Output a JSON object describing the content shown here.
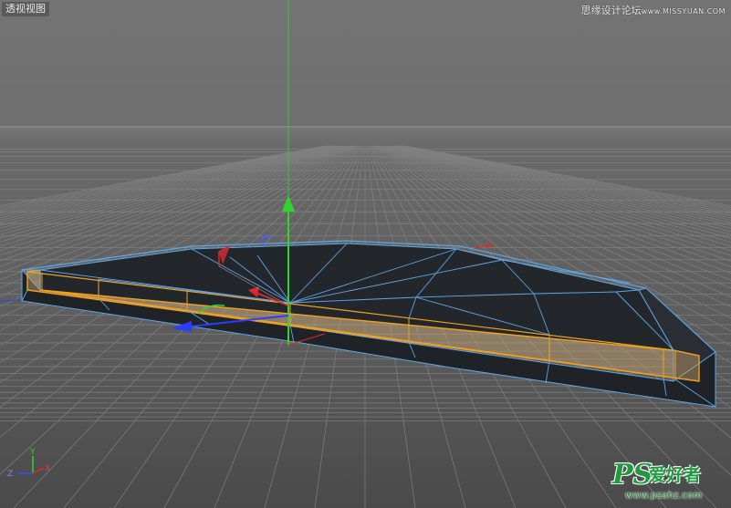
{
  "viewport": {
    "view_label": "透视视图"
  },
  "watermark_top": {
    "text": "思缘设计论坛",
    "url": "www.MISSYUAN.COM"
  },
  "watermark_bottom": {
    "brand": "PS",
    "chinese": "爱好者",
    "url": "www.psahz.com"
  },
  "axis_indicator": {
    "y_label": "Y",
    "z_label": "Z",
    "x_label": "X",
    "colors": {
      "x": "#e02828",
      "y": "#2fd42f",
      "z": "#3a4cff"
    }
  },
  "colors": {
    "wireframe": "#5ea7e6",
    "face_dark": "#23262b",
    "selected_edge": "#f0a020",
    "grid": "#8c8c8c"
  }
}
